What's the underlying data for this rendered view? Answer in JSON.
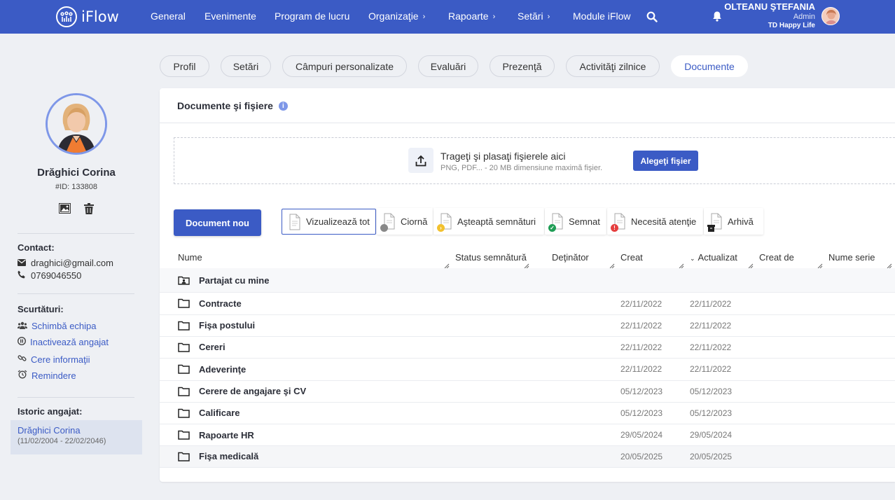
{
  "app": {
    "logo_text": "iFlow"
  },
  "nav": [
    {
      "label": "General",
      "chevron": false
    },
    {
      "label": "Evenimente",
      "chevron": false
    },
    {
      "label": "Program de lucru",
      "chevron": false
    },
    {
      "label": "Organizaţie",
      "chevron": true
    },
    {
      "label": "Rapoarte",
      "chevron": true
    },
    {
      "label": "Setări",
      "chevron": true
    },
    {
      "label": "Module iFlow",
      "chevron": false
    }
  ],
  "chevron_glyph": "›",
  "user": {
    "name": "OLTEANU ŞTEFANIA",
    "role": "Admin",
    "company": "TD Happy Life"
  },
  "profile": {
    "name": "Drăghici Corina",
    "id": "#ID: 133808"
  },
  "contact": {
    "title": "Contact:",
    "email": "draghici@gmail.com",
    "phone": "0769046550"
  },
  "shortcuts": {
    "title": "Scurtături:",
    "items": [
      "Schimbă echipa",
      "Inactivează angajat",
      "Cere informaţii",
      "Remindere"
    ]
  },
  "history": {
    "title": "Istoric angajat:",
    "name": "Drăghici Corina",
    "period": "(11/02/2004 - 22/02/2046)"
  },
  "tabs": [
    "Profil",
    "Setări",
    "Câmpuri personalizate",
    "Evaluări",
    "Prezenţă",
    "Activităţi zilnice",
    "Documente"
  ],
  "active_tab": "Documente",
  "panel": {
    "title": "Documente şi fişiere"
  },
  "upload": {
    "main": "Trageţi şi plasaţi fişierele aici",
    "sub": "PNG, PDF... - 20 MB dimensiune maximă fişier.",
    "button": "Alegeţi fişier"
  },
  "new_doc_button": "Document nou",
  "filters": [
    {
      "label": "Vizualizează tot",
      "badge": "none",
      "badge_color": ""
    },
    {
      "label": "Ciornă",
      "badge": "dot",
      "badge_color": "#888888"
    },
    {
      "label": "Aşteaptă semnături",
      "badge": "arrow",
      "badge_color": "#f2c12e"
    },
    {
      "label": "Semnat",
      "badge": "check",
      "badge_color": "#1f9d55"
    },
    {
      "label": "Necesită atenţie",
      "badge": "alert",
      "badge_color": "#e53e3e"
    },
    {
      "label": "Arhivă",
      "badge": "box",
      "badge_color": "#222222"
    }
  ],
  "columns": [
    "Nume",
    "Status semnătură",
    "Deţinător",
    "Creat",
    "Actualizat",
    "Creat de",
    "Nume serie"
  ],
  "rows": [
    {
      "name": "Partajat cu mine",
      "icon": "shared-folder",
      "created": "",
      "updated": ""
    },
    {
      "name": "Contracte",
      "icon": "folder",
      "created": "22/11/2022",
      "updated": "22/11/2022"
    },
    {
      "name": "Fişa postului",
      "icon": "folder",
      "created": "22/11/2022",
      "updated": "22/11/2022"
    },
    {
      "name": "Cereri",
      "icon": "folder",
      "created": "22/11/2022",
      "updated": "22/11/2022"
    },
    {
      "name": "Adeverinţe",
      "icon": "folder",
      "created": "22/11/2022",
      "updated": "22/11/2022"
    },
    {
      "name": "Cerere de angajare şi CV",
      "icon": "folder",
      "created": "05/12/2023",
      "updated": "05/12/2023"
    },
    {
      "name": "Calificare",
      "icon": "folder",
      "created": "05/12/2023",
      "updated": "05/12/2023"
    },
    {
      "name": "Rapoarte HR",
      "icon": "folder",
      "created": "29/05/2024",
      "updated": "29/05/2024"
    },
    {
      "name": "Fişa medicală",
      "icon": "folder",
      "created": "20/05/2025",
      "updated": "20/05/2025"
    }
  ],
  "colors": {
    "brand": "#3b5bc5",
    "accent_light": "#7e97e8"
  }
}
